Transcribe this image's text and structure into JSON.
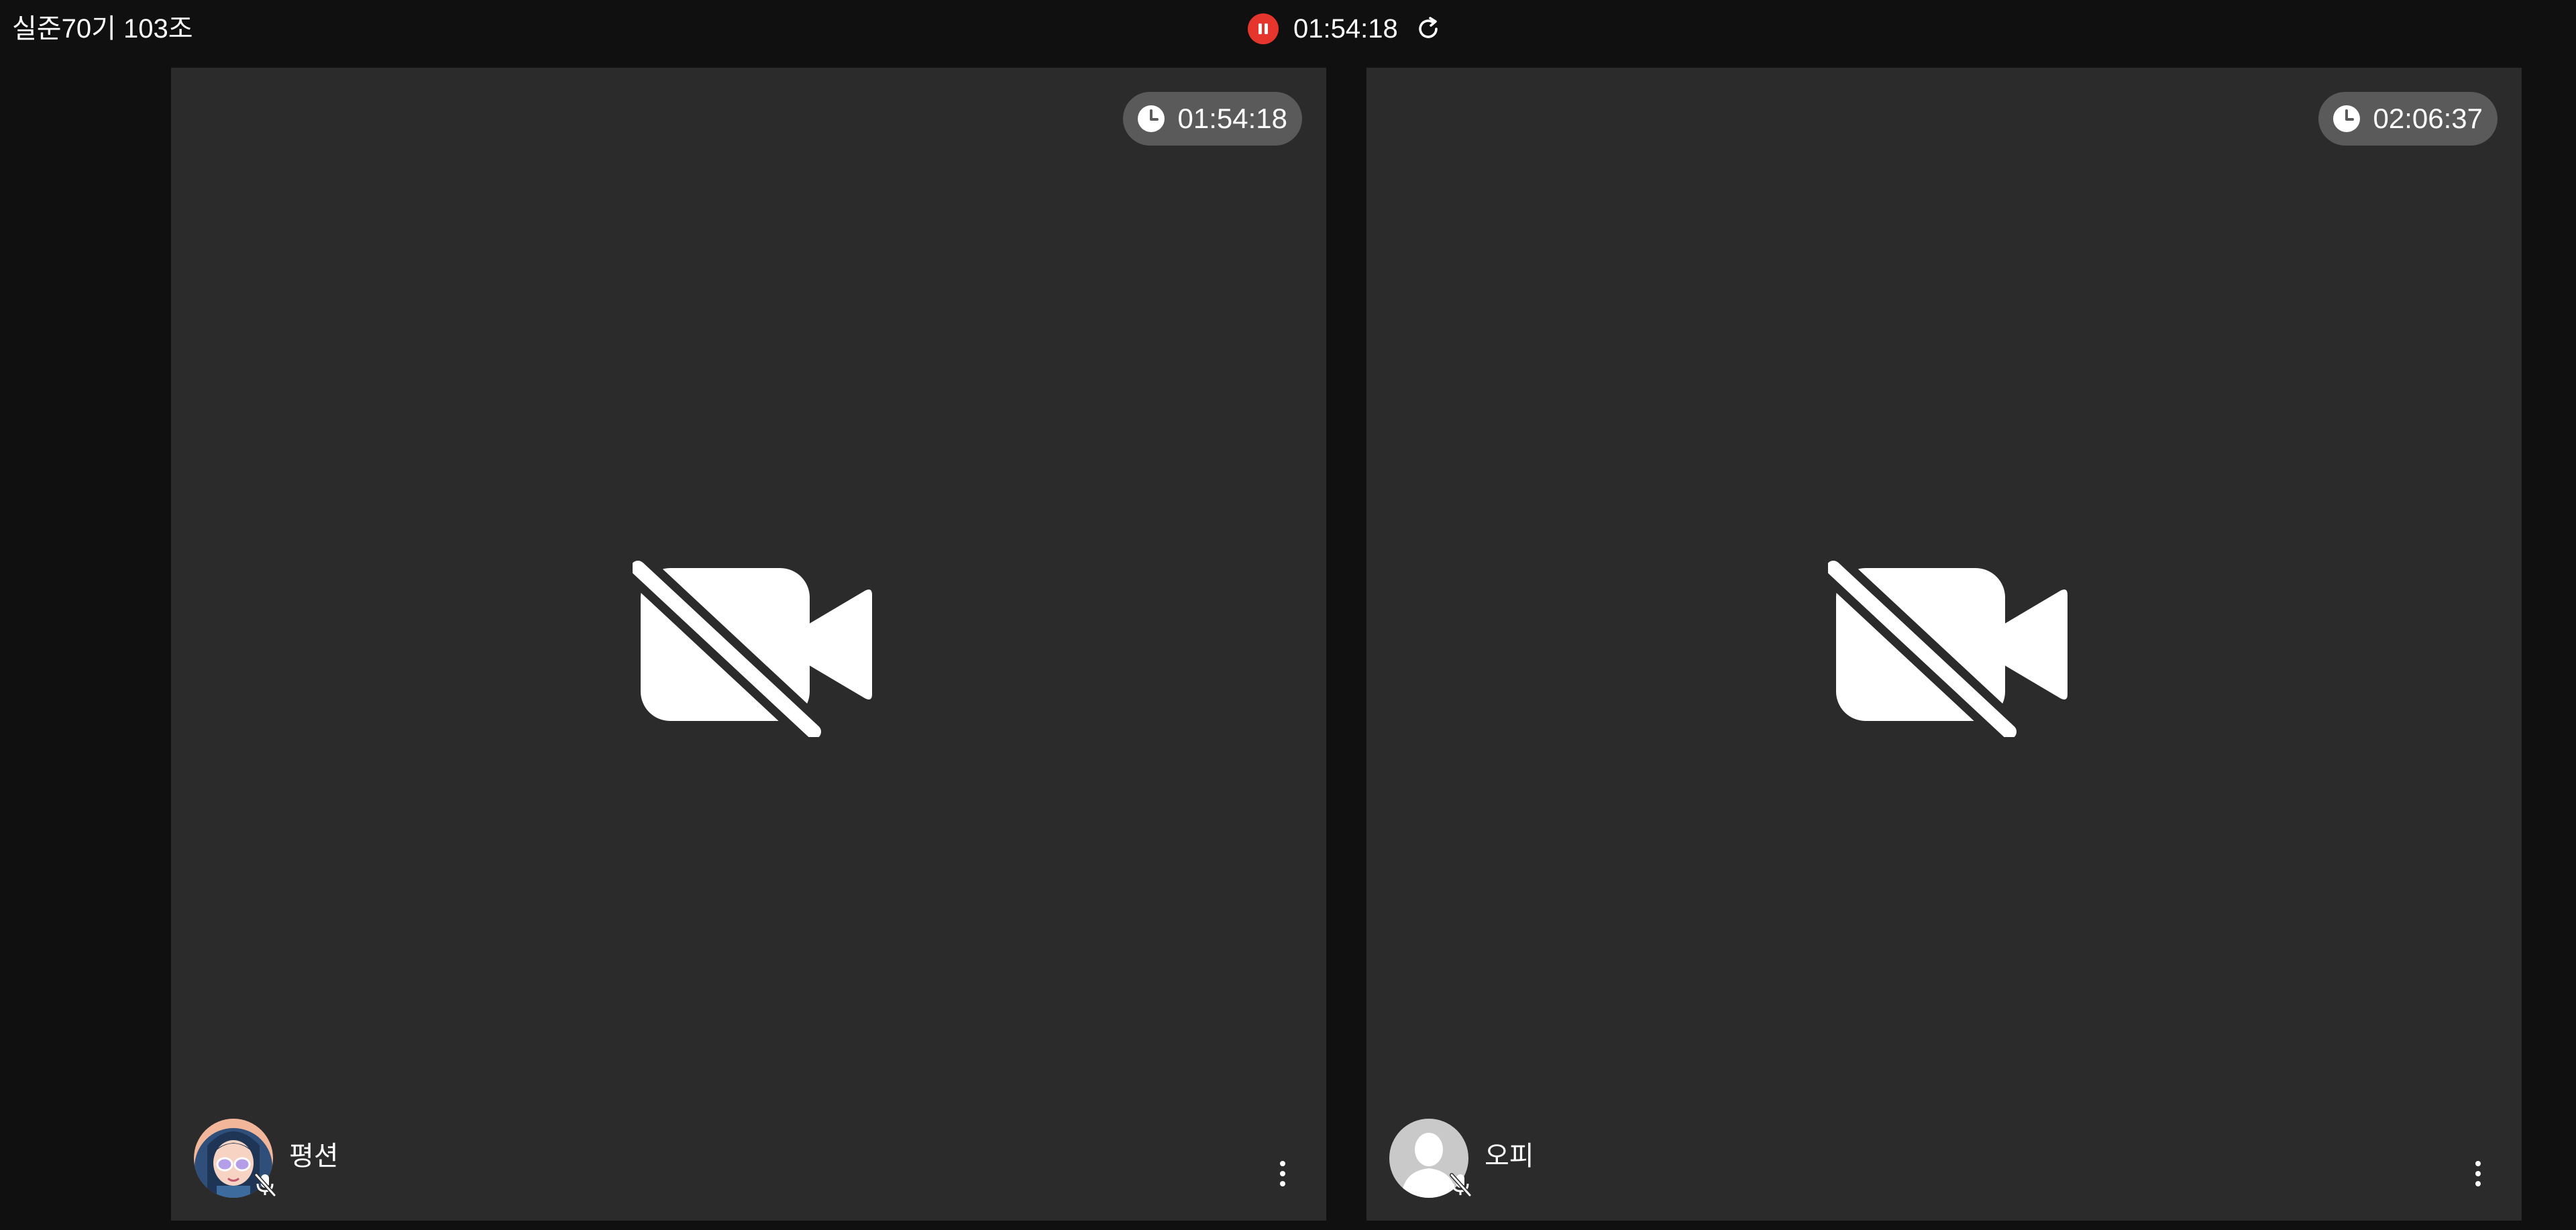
{
  "header": {
    "room_title": "실준70기 103조",
    "recording_time": "01:54:18"
  },
  "colors": {
    "background": "#101010",
    "tile": "#2b2b2b",
    "badge": "#5a5a5a",
    "record_red": "#e5352d"
  },
  "participants": [
    {
      "name": "평션",
      "elapsed": "01:54:18",
      "avatar": "character-avatar",
      "camera": "off",
      "mic": "muted"
    },
    {
      "name": "오피",
      "elapsed": "02:06:37",
      "avatar": "default-person-avatar",
      "camera": "off",
      "mic": "muted"
    }
  ]
}
